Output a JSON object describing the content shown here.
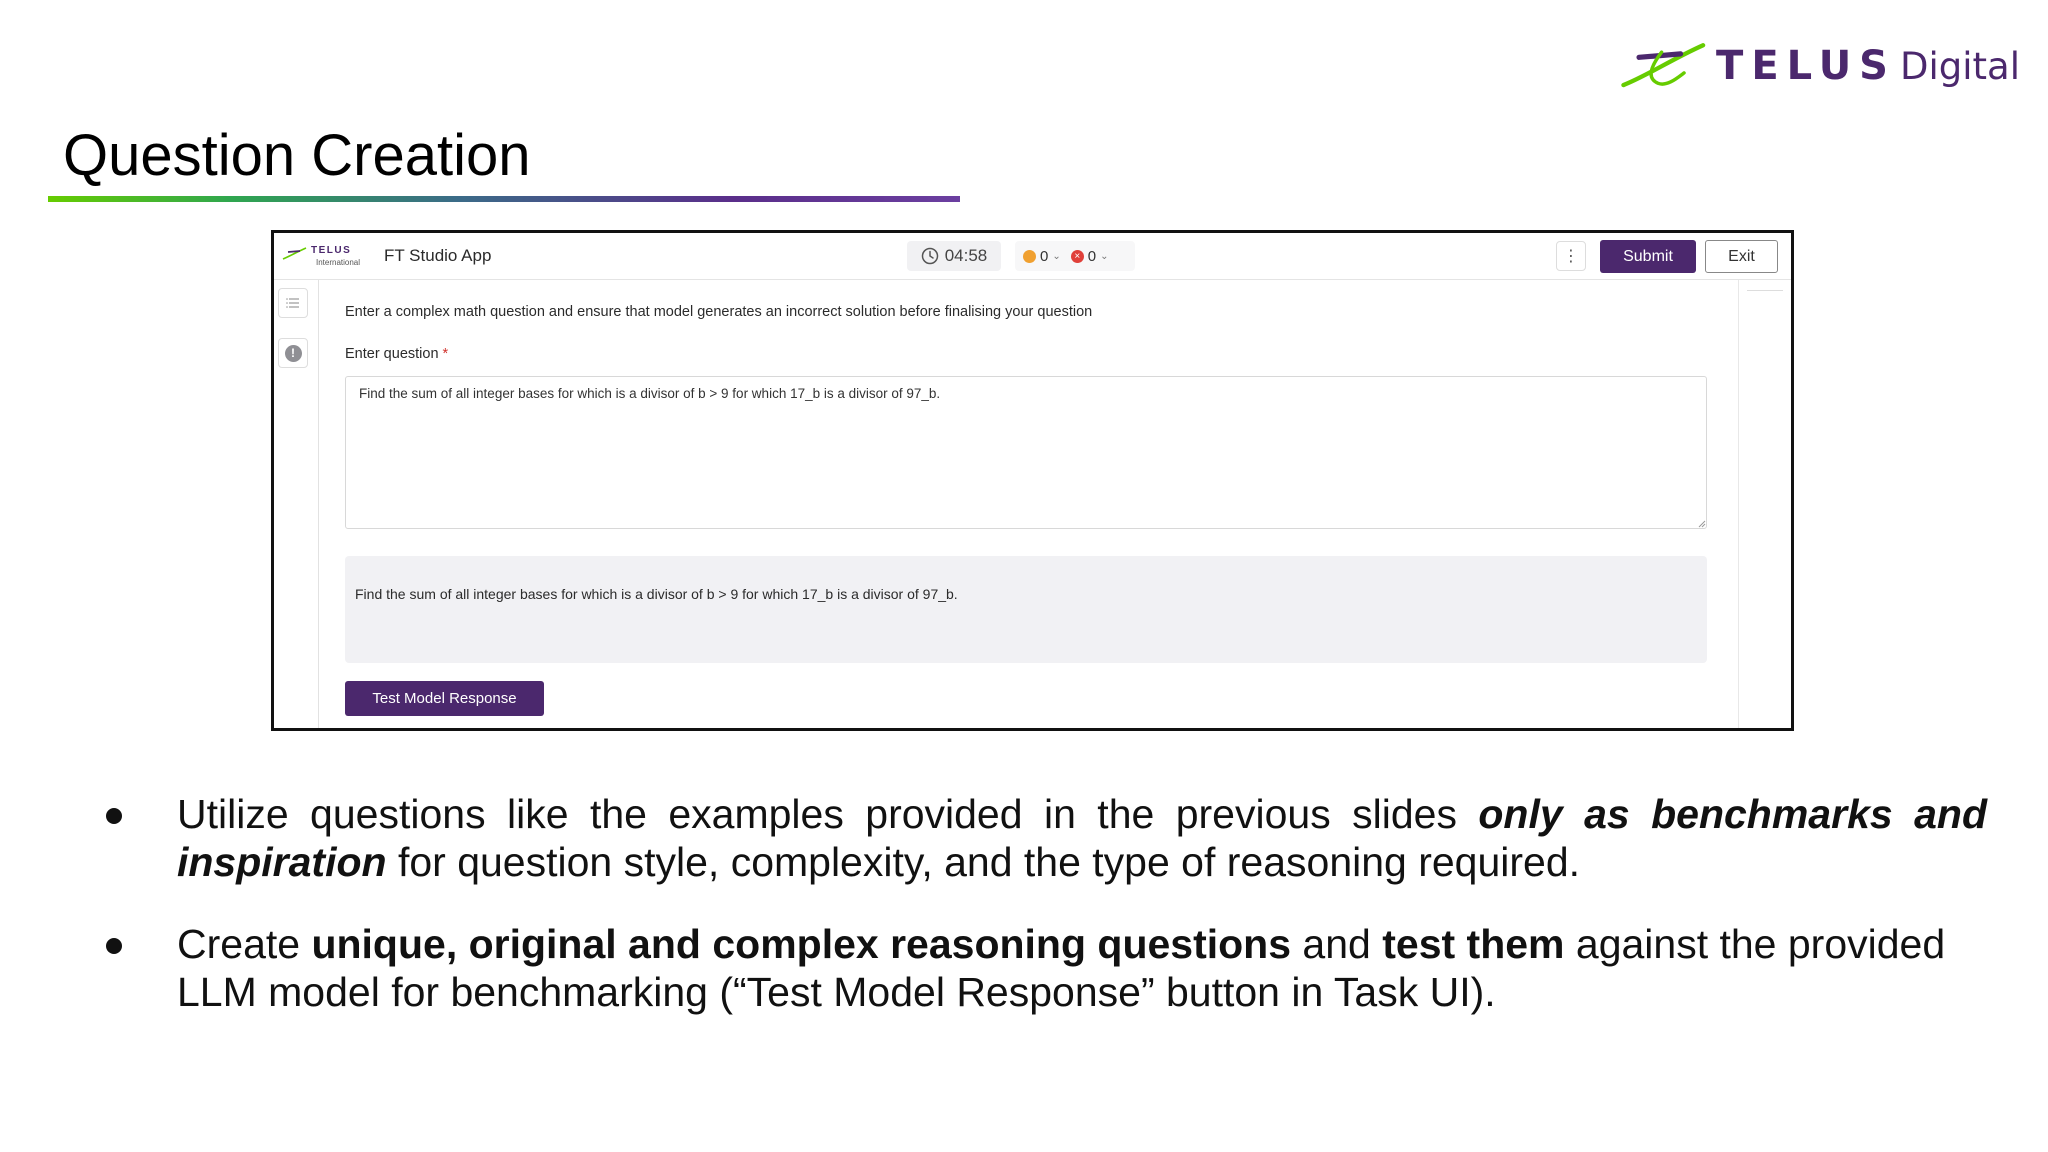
{
  "brand": {
    "name": "TELUS",
    "suffix": "Digital",
    "color": "#4b286d",
    "accent": "#66cc00"
  },
  "slide": {
    "title": "Question Creation"
  },
  "app": {
    "logo_top": "TELUS",
    "logo_bottom": "International",
    "name": "FT Studio App",
    "timer": "04:58",
    "counter_warnings": "0",
    "counter_errors": "0",
    "submit_label": "Submit",
    "exit_label": "Exit",
    "kebab": "⋮",
    "instruction": "Enter a complex math question and ensure that model generates an incorrect solution before finalising your question",
    "question_label": "Enter question",
    "required_mark": "*",
    "question_value": "Find the sum of all integer bases for which is a divisor of b > 9 for which 17_b is a divisor of 97_b.",
    "preview_text": "Find the sum of all integer bases for which is a divisor of b > 9 for which 17_b is a divisor of 97_b.",
    "test_button_label": "Test Model Response",
    "primary_color": "#4b286d"
  },
  "bullets": [
    {
      "pre": "Utilize questions like the examples provided in the previous slides ",
      "emph": "only as benchmarks and inspiration",
      "post": " for question style, complexity, and the type of reasoning required."
    },
    {
      "pre": "Create ",
      "bold1": "unique, original and complex reasoning questions",
      "mid": " and ",
      "bold2": "test them",
      "post": " against the provided LLM model for benchmarking (“Test Model Response” button in Task UI)."
    }
  ]
}
